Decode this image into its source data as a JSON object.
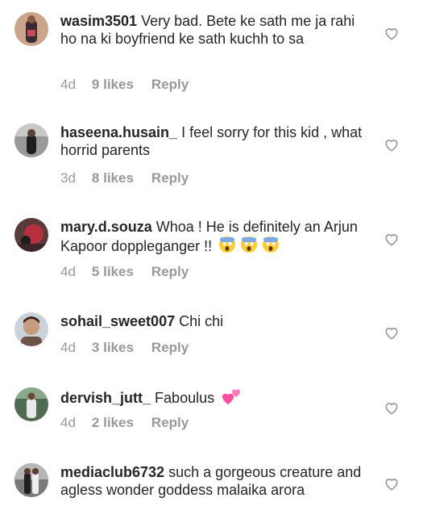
{
  "comments": [
    {
      "username": "wasim3501",
      "text": " Very bad. Bete ke sath me ja rahi ho na ki boyfriend ke sath kuchh to sa",
      "age": "4d",
      "likes": "9 likes",
      "reply": "Reply",
      "avatar": {
        "bg": "#caa58a",
        "fg": "#3a2a33",
        "accent": "#c34a5a"
      }
    },
    {
      "username": "haseena.husain_",
      "text": " I feel sorry for this kid , what horrid parents",
      "age": "3d",
      "likes": "8 likes",
      "reply": "Reply",
      "avatar": {
        "bg": "#9a9a9a",
        "fg": "#1e1e1e",
        "accent": "#d8d8d8"
      }
    },
    {
      "username": "mary.d.souza",
      "text": " Whoa ! He is definitely an Arjun Kapoor doppleganger !! ",
      "emoji": "scream-emoji",
      "age": "4d",
      "likes": "5 likes",
      "reply": "Reply",
      "avatar": {
        "bg": "#5a3b3b",
        "fg": "#b83040",
        "accent": "#1c1c1c"
      }
    },
    {
      "username": "sohail_sweet007",
      "text": " Chi chi",
      "age": "4d",
      "likes": "3 likes",
      "reply": "Reply",
      "avatar": {
        "bg": "#c9d3d9",
        "fg": "#6b5447",
        "accent": "#f0f0f0"
      }
    },
    {
      "username": "dervish_jutt_",
      "text": " Faboulus ",
      "emoji": "two-hearts-emoji",
      "age": "4d",
      "likes": "2 likes",
      "reply": "Reply",
      "avatar": {
        "bg": "#4f6b52",
        "fg": "#e8e8e8",
        "accent": "#2b2b2b"
      }
    },
    {
      "username": "mediaclub6732",
      "text": " such a gorgeous creature and agless wonder goddess malaika arora",
      "age": "",
      "likes": "",
      "reply": "",
      "avatar": {
        "bg": "#7a7a7a",
        "fg": "#202020",
        "accent": "#eeeeee"
      }
    }
  ],
  "icons": {
    "like": "heart-outline-icon"
  },
  "colors": {
    "text": "#262626",
    "meta": "#999999",
    "heart": "#999999",
    "emoji_face": "#ffcc33",
    "emoji_heart": "#ff4fa0"
  }
}
